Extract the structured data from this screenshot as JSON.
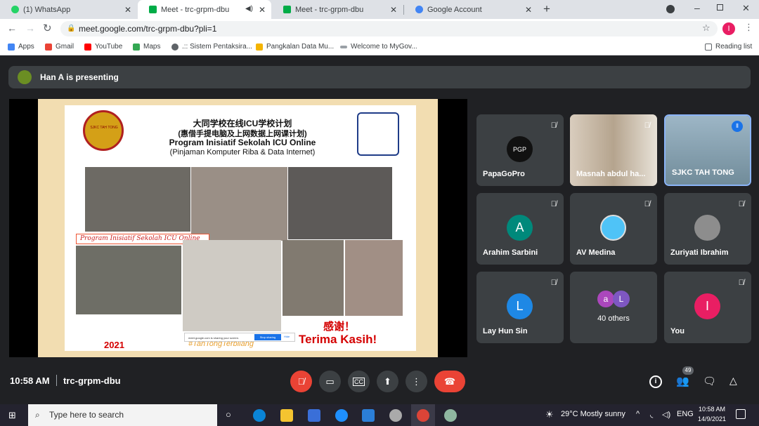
{
  "browser": {
    "tabs": [
      {
        "label": "(1) WhatsApp"
      },
      {
        "label": "Meet - trc-grpm-dbu"
      },
      {
        "label": "Meet - trc-grpm-dbu"
      },
      {
        "label": "Google Account"
      }
    ],
    "url": "meet.google.com/trc-grpm-dbu?pli=1",
    "profile_initial": "I",
    "bookmarks": [
      "Apps",
      "Gmail",
      "YouTube",
      "Maps",
      ".:: Sistem Pentaksira...",
      "Pangkalan Data Mu...",
      "Welcome to MyGov..."
    ],
    "reading_list": "Reading list"
  },
  "meet": {
    "presenting": "Han A is presenting",
    "slide": {
      "title_cn1": "大同学校在线ICU学校计划",
      "title_cn2": "(惠借手提电脑及上网数据上网课计划)",
      "title_ms": "Program Inisiatif Sekolah ICU Online",
      "subtitle": "(Pinjaman Komputer Riba & Data Internet)",
      "caption": "Program Inisiatif Sekolah ICU Online",
      "thanks_cn": "感谢！",
      "thanks_ms": "Terima Kasih!",
      "year": "2021",
      "hashtag": "#TahTongTerbilang",
      "school_logo": "SJKC TAH TONG",
      "share_text": "meet.google.com is sharing your screen.",
      "stop_share": "Stop sharing",
      "hide": "Hide"
    },
    "participants": [
      {
        "name": "PapaGoPro",
        "initial": "PGP",
        "color": "#111111"
      },
      {
        "name": "Masnah abdul ha...",
        "initial": "",
        "color": "#c9b9a5"
      },
      {
        "name": "SJKC TAH TONG",
        "initial": "",
        "color": "#8fa6b6"
      },
      {
        "name": "Arahim Sarbini",
        "initial": "A",
        "color": "#00897b"
      },
      {
        "name": "AV Medina",
        "initial": "",
        "color": "#4fc3f7"
      },
      {
        "name": "Zuriyati Ibrahim",
        "initial": "",
        "color": "#8d8d8d"
      },
      {
        "name": "Lay Hun Sin",
        "initial": "L",
        "color": "#1e88e5"
      },
      {
        "name": "40 others",
        "a1": "a",
        "a2": "L",
        "c1": "#ab47bc",
        "c2": "#7e57c2"
      },
      {
        "name": "You",
        "initial": "I",
        "color": "#e91e63"
      }
    ],
    "time": "10:58 AM",
    "code": "trc-grpm-dbu",
    "people_count": "49"
  },
  "taskbar": {
    "search_placeholder": "Type here to search",
    "weather": "29°C  Mostly sunny",
    "lang": "ENG",
    "time": "10:58 AM",
    "date": "14/9/2021"
  }
}
